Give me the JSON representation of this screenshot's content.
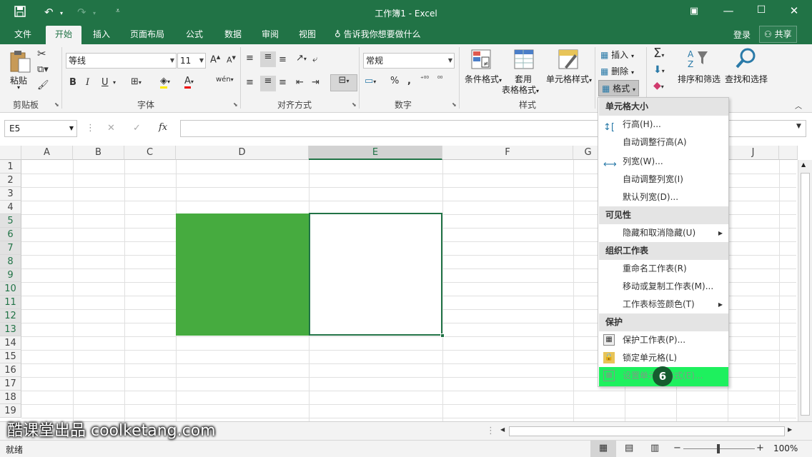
{
  "titlebar": {
    "title": "工作簿1 - Excel"
  },
  "tabs": [
    {
      "label": "文件"
    },
    {
      "label": "开始"
    },
    {
      "label": "插入"
    },
    {
      "label": "页面布局"
    },
    {
      "label": "公式"
    },
    {
      "label": "数据"
    },
    {
      "label": "审阅"
    },
    {
      "label": "视图"
    }
  ],
  "tell_me": "告诉我你想要做什么",
  "login": "登录",
  "share": "共享",
  "ribbon": {
    "paste": "粘贴",
    "clipboard": "剪贴板",
    "font_name": "等线",
    "font_size": "11",
    "font_group": "字体",
    "align_group": "对齐方式",
    "number_format": "常规",
    "number_group": "数字",
    "cond_format": "条件格式",
    "table_format_1": "套用",
    "table_format_2": "表格格式",
    "cell_style": "单元格样式",
    "style_group": "样式",
    "insert": "插入",
    "delete": "删除",
    "format": "格式",
    "sort_filter": "排序和筛选",
    "find_select": "查找和选择",
    "bold": "B",
    "italic": "I",
    "underline": "U"
  },
  "formula": {
    "namebox": "E5",
    "fx": "fx"
  },
  "columns": [
    "A",
    "B",
    "C",
    "D",
    "E",
    "F",
    "G",
    "J"
  ],
  "rows": [
    "1",
    "2",
    "3",
    "4",
    "5",
    "6",
    "7",
    "8",
    "9",
    "10",
    "11",
    "12",
    "13",
    "14",
    "15",
    "16",
    "17",
    "18",
    "19"
  ],
  "menu": {
    "sec1": "单元格大小",
    "row_height": "行高(H)...",
    "autofit_row": "自动调整行高(A)",
    "col_width": "列宽(W)...",
    "autofit_col": "自动调整列宽(I)",
    "default_width": "默认列宽(D)...",
    "sec2": "可见性",
    "hide_unhide": "隐藏和取消隐藏(U)",
    "sec3": "组织工作表",
    "rename": "重命名工作表(R)",
    "move_copy": "移动或复制工作表(M)...",
    "tab_color": "工作表标签颜色(T)",
    "sec4": "保护",
    "protect": "保护工作表(P)...",
    "lock": "锁定单元格(L)",
    "format_cells": "设置单元格格式(E)..."
  },
  "step_badge": "6",
  "status": {
    "ready": "就绪",
    "zoom": "100%"
  },
  "watermark": "酷课堂出品 coolketang.com",
  "colors": {
    "excel_green": "#217346",
    "fill_green": "#46ab3f",
    "highlight": "#1ef05e"
  }
}
